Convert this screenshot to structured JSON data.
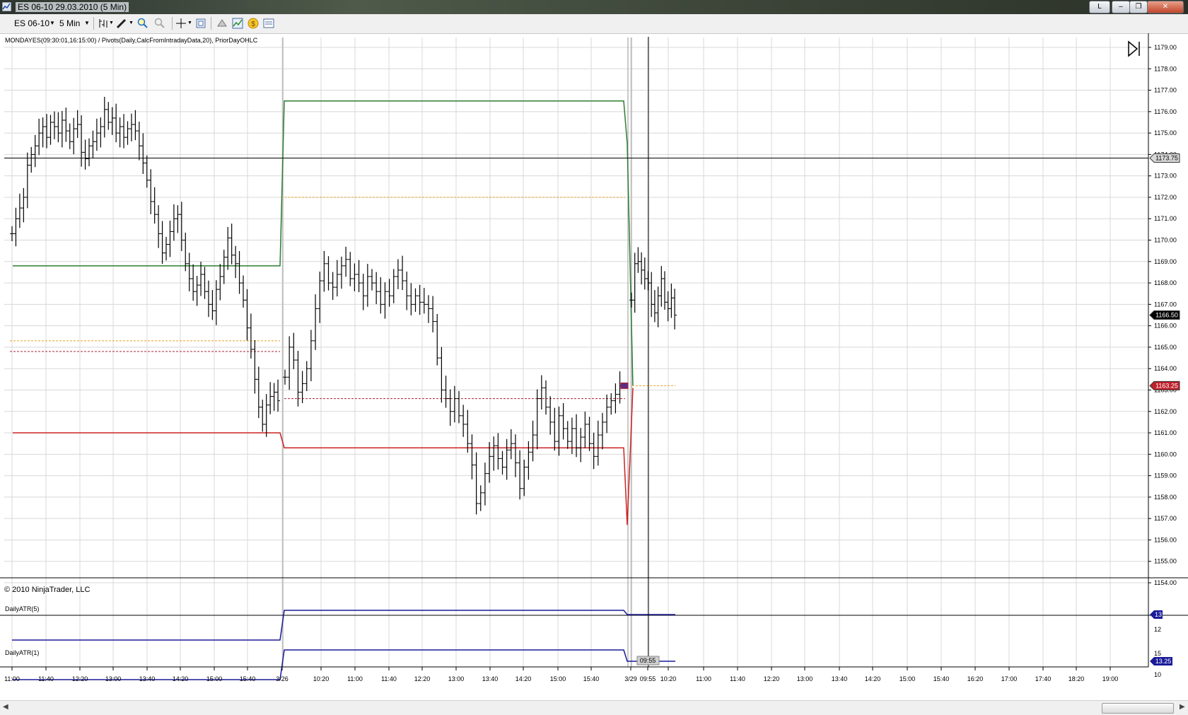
{
  "window": {
    "title": "ES 06-10  29.03.2010 (5 Min)",
    "buttons": [
      "L",
      "–",
      "❐",
      "✕"
    ]
  },
  "toolbar": {
    "instrument": "ES 06-10",
    "interval": "5 Min",
    "icons": [
      "bar-style-icon",
      "draw-pencil-icon",
      "zoom-in-icon",
      "zoom-out-icon",
      "crosshair-icon",
      "properties-icon",
      "data-box-icon",
      "indicators-icon",
      "strategies-icon",
      "order-icon"
    ]
  },
  "chart_header": {
    "indicators_text": "MONDAYES(09:30:01,16:15:00) / Pivots(Daily,CalcFromIntradayData,20),  PriorDayOHLC",
    "copyright": "© 2010 NinjaTrader, LLC"
  },
  "price_markers": {
    "crosshair_price": "1173.75",
    "last_price": "1166.50",
    "current_level": "1163.25"
  },
  "atr5": {
    "label": "DailyATR(5)",
    "value": "13",
    "scale": [
      "12"
    ]
  },
  "atr1": {
    "label": "DailyATR(1)",
    "value": "13.25",
    "scale": [
      "15",
      "10"
    ]
  },
  "x_labels": [
    "11:00",
    "11:40",
    "12:20",
    "13:00",
    "13:40",
    "14:20",
    "15:00",
    "15:40",
    "3/26",
    "10:20",
    "11:00",
    "11:40",
    "12:20",
    "13:00",
    "13:40",
    "14:20",
    "15:00",
    "15:40",
    "3/29",
    "09:55",
    "10:20",
    "11:00",
    "11:40",
    "12:20",
    "13:00",
    "13:40",
    "14:20",
    "15:00",
    "15:40",
    "16:20",
    "17:00",
    "17:40",
    "18:20",
    "19:00"
  ],
  "colors": {
    "up_line": "#2e7d32",
    "down_line": "#cc2222",
    "orange_dash": "#e6a020",
    "red_dash": "#aa2233",
    "atr_line": "#1a1a99",
    "grid": "#d8d8d8"
  },
  "chart_data": {
    "type": "ohlc",
    "y_range": [
      1153.5,
      1179.5
    ],
    "y_ticks": [
      "1179.00",
      "1178.00",
      "1177.00",
      "1176.00",
      "1175.00",
      "1174.00",
      "1173.00",
      "1172.00",
      "1171.00",
      "1170.00",
      "1169.00",
      "1168.00",
      "1167.00",
      "1166.00",
      "1165.00",
      "1164.00",
      "1163.00",
      "1162.00",
      "1161.00",
      "1160.00",
      "1159.00",
      "1158.00",
      "1157.00",
      "1156.00",
      "1155.00",
      "1154.00"
    ],
    "series": [
      {
        "name": "price",
        "closes": [
          1170.3,
          1171,
          1171.5,
          1172,
          1173.5,
          1174,
          1174.4,
          1175,
          1175.3,
          1174.8,
          1175.5,
          1175.3,
          1175,
          1175.6,
          1175.1,
          1174.6,
          1175.2,
          1175.4,
          1174.1,
          1173.8,
          1174.4,
          1174.6,
          1175,
          1175.3,
          1176.1,
          1175.5,
          1175.7,
          1175,
          1175.3,
          1174.8,
          1175.2,
          1175.4,
          1175.1,
          1174.4,
          1173.6,
          1172.8,
          1171.8,
          1171.2,
          1170.3,
          1169.4,
          1169.8,
          1170.4,
          1171,
          1171.2,
          1170,
          1168.9,
          1168.2,
          1167.6,
          1167.9,
          1168.4,
          1167.6,
          1167.0,
          1166.7,
          1167.7,
          1168.3,
          1169.2,
          1170.1,
          1169.3,
          1168.9,
          1168.0,
          1167.2,
          1165.9,
          1164.9,
          1163.5,
          1162.2,
          1161.4,
          1162.3,
          1162.7,
          1162.9,
          1162.5
        ]
      },
      {
        "name": "price_b",
        "closes": [
          1163.6,
          1165.0,
          1164.4,
          1162.9,
          1163.3,
          1164.0,
          1165.3,
          1166.8,
          1168.1,
          1168.9,
          1168.0,
          1167.8,
          1168.4,
          1168.8,
          1169.1,
          1168.2,
          1168.4,
          1168.0,
          1167.4,
          1168.3,
          1168.0,
          1167.6,
          1167.0,
          1167.6,
          1167.4,
          1168.3,
          1168.6,
          1168.1,
          1167.4,
          1167.0,
          1167.4,
          1167.1,
          1167.0,
          1166.8,
          1166.2,
          1164.5,
          1163.0,
          1162.6,
          1162.0,
          1162.6,
          1161.8,
          1161.4,
          1160.5,
          1159.5,
          1157.7,
          1158.2,
          1159.1,
          1159.9,
          1160.4,
          1159.8,
          1159.4,
          1160.2,
          1160.5,
          1159.6,
          1158.4,
          1159.4,
          1160.1,
          1160.9,
          1162.6,
          1163.1,
          1162.2,
          1161.5,
          1160.6,
          1161.8,
          1161.2,
          1160.6,
          1161.2,
          1160.3,
          1160.8,
          1161.4,
          1160.5,
          1159.9,
          1160.9,
          1161.5,
          1162.2,
          1162.5,
          1162.8,
          1163.2
        ]
      },
      {
        "name": "price_c",
        "closes": [
          1167.2,
          1168.9,
          1169.0,
          1168.6,
          1168.2,
          1168.0,
          1167.0,
          1166.6,
          1167.4,
          1168.2,
          1167.1,
          1166.8,
          1167.3,
          1166.5
        ]
      }
    ]
  }
}
